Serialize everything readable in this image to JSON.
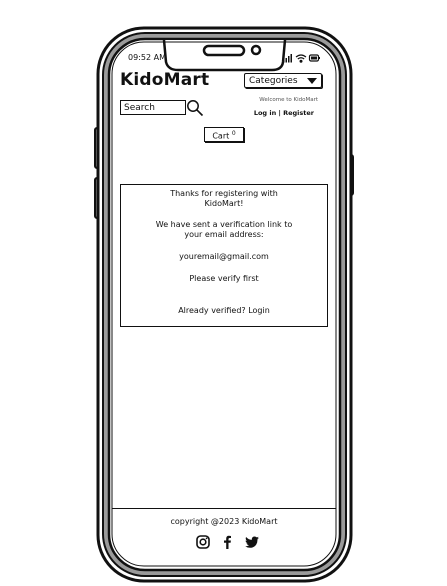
{
  "status_bar": {
    "time": "09:52 AM"
  },
  "header": {
    "brand": "KidoMart",
    "categories_label": "Categories",
    "search_placeholder": "Search",
    "welcome_text": "Welcome to KidoMart",
    "auth_links": "Log in | Register",
    "cart_label": "Cart",
    "cart_count": "0"
  },
  "message": {
    "thanks": "Thanks for registering with KidoMart!",
    "sent": "We have sent a verification link to your email address:",
    "email": "youremail@gmail.com",
    "verify": "Please verify first",
    "login_prompt": "Already verified? Login"
  },
  "footer": {
    "copyright": "copyright @2023 KidoMart",
    "social": [
      "instagram-icon",
      "facebook-icon",
      "twitter-icon"
    ]
  }
}
